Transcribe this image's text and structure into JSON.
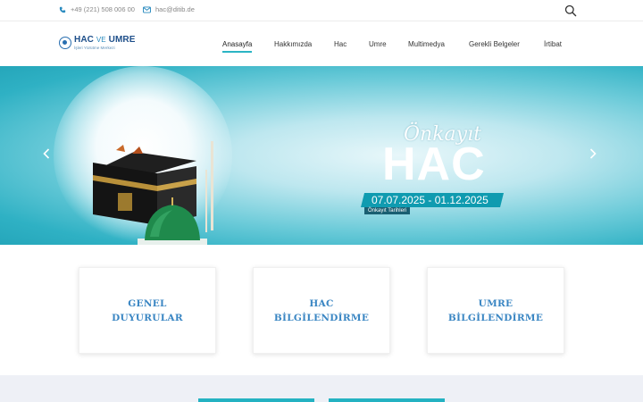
{
  "topbar": {
    "phone": "+49 (221) 508 006 00",
    "email": "hac@ditib.de",
    "phone_icon": "phone-icon",
    "email_icon": "envelope-icon",
    "search_icon": "search-icon"
  },
  "logo": {
    "main_left": "HAC",
    "main_mid": "VE",
    "main_right": "UMRE",
    "sub": "İşleri Yürütme Merkezi"
  },
  "nav": {
    "items": [
      {
        "label": "Anasayfa",
        "active": true
      },
      {
        "label": "Hakkımızda",
        "active": false
      },
      {
        "label": "Hac",
        "active": false
      },
      {
        "label": "Umre",
        "active": false
      },
      {
        "label": "Multimedya",
        "active": false
      },
      {
        "label": "Gerekli Belgeler",
        "active": false
      },
      {
        "label": "İrtibat",
        "active": false
      }
    ]
  },
  "slider": {
    "script_title": "Önkayıt",
    "title": "HAC",
    "dates": "07.07.2025 - 01.12.2025",
    "caption": "Önkayıt Tarihleri",
    "prev_icon": "chevron-left-icon",
    "next_icon": "chevron-right-icon"
  },
  "cards": [
    {
      "line1": "GENEL",
      "line2": "DUYURULAR"
    },
    {
      "line1": "HAC",
      "line2": "BİLGİLENDİRME"
    },
    {
      "line1": "UMRE",
      "line2": "BİLGİLENDİRME"
    }
  ],
  "colors": {
    "accent": "#2bb5c4",
    "brand_blue": "#1e4f8a",
    "card_text": "#3a86c3",
    "slider_teal": "#2fb1c4"
  }
}
